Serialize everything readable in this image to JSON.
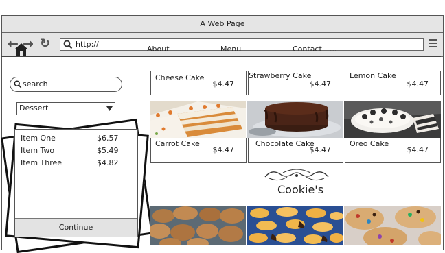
{
  "browser": {
    "title": "A Web Page",
    "url": "http://"
  },
  "nav": {
    "items": [
      "About",
      "Menu",
      "Contact",
      "..."
    ]
  },
  "sidebar": {
    "search_placeholder": "search",
    "category": "Dessert",
    "cart_items": [
      {
        "name": "Item One",
        "price": "$6.57"
      },
      {
        "name": "Item Two",
        "price": "$5.49"
      },
      {
        "name": "Item Three",
        "price": "$4.82"
      }
    ],
    "continue_label": "Continue"
  },
  "products_top": [
    {
      "name": "Cheese Cake",
      "price": "$4.47"
    },
    {
      "name": "Strawberry Cake",
      "price": "$4.47"
    },
    {
      "name": "Lemon Cake",
      "price": "$4.47"
    }
  ],
  "products_mid": [
    {
      "name": "Carrot Cake",
      "price": "$4.47"
    },
    {
      "name": "Chocolate Cake",
      "price": "$4.47"
    },
    {
      "name": "Oreo Cake",
      "price": "$4.47"
    }
  ],
  "section": {
    "title": "Cookie's"
  },
  "icons": [
    "back-arrow-icon",
    "forward-arrow-icon",
    "refresh-icon",
    "search-icon",
    "menu-icon",
    "home-icon",
    "chevron-down-icon",
    "flourish-ornament-icon"
  ]
}
